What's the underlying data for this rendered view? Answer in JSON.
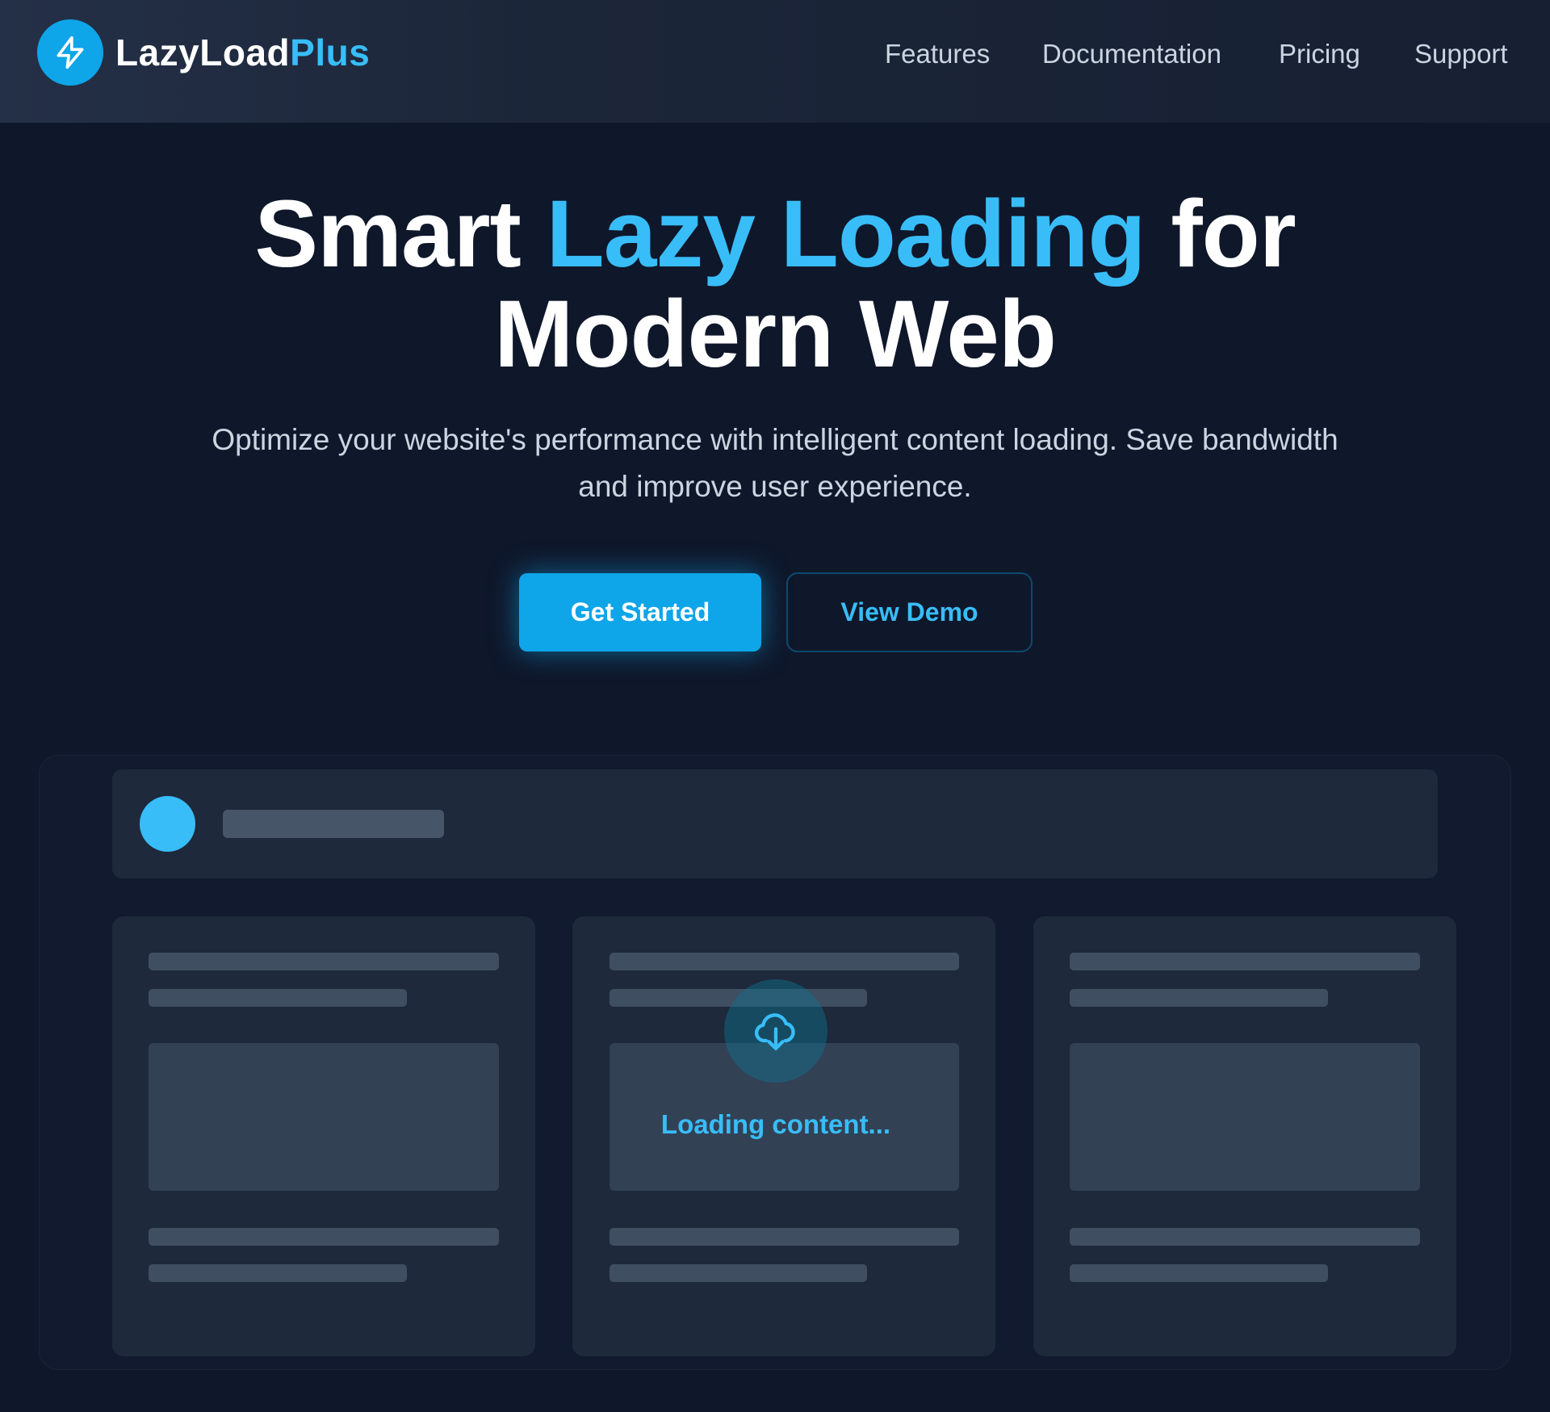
{
  "brand": {
    "name_part1": "LazyLoad",
    "name_part2": "Plus",
    "logo_icon": "lightning-bolt-icon"
  },
  "nav": {
    "links": [
      {
        "label": "Features"
      },
      {
        "label": "Documentation"
      },
      {
        "label": "Pricing"
      },
      {
        "label": "Support"
      }
    ]
  },
  "hero": {
    "title_part1": "Smart ",
    "title_accent": "Lazy Loading",
    "title_part2": " for",
    "title_line2": "Modern Web",
    "subtitle": "Optimize your website's performance with intelligent content loading. Save bandwidth and improve user experience.",
    "primary_button": "Get Started",
    "secondary_button": "View Demo"
  },
  "preview": {
    "loading_text": "Loading content...",
    "loading_icon": "cloud-download-icon"
  },
  "colors": {
    "background": "#0f172a",
    "accent": "#38bdf8",
    "button_primary": "#0ea5e9",
    "skeleton": "#475569",
    "card": "#1e293b"
  }
}
